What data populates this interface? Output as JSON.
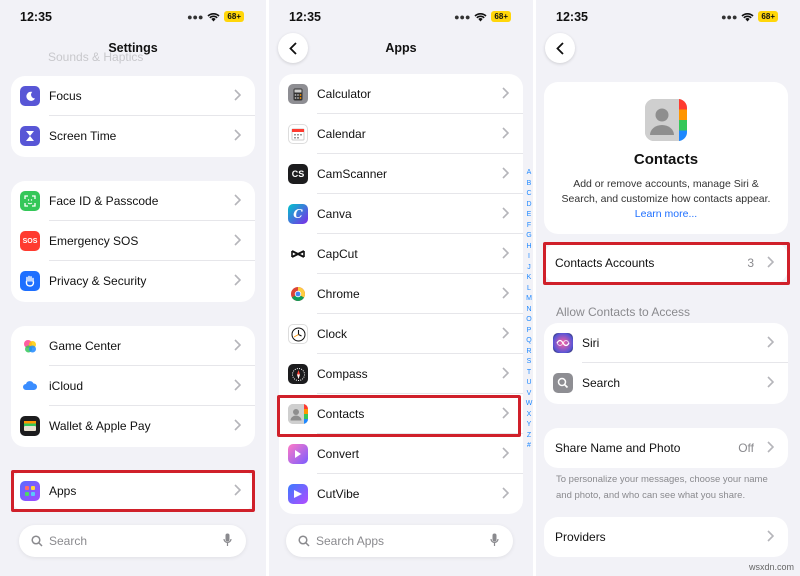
{
  "status": {
    "time": "12:35",
    "battery": "68+"
  },
  "settings": {
    "title": "Settings",
    "faded_top": "Sounds & Haptics",
    "groups": [
      [
        {
          "label": "Focus",
          "icon": "moon-icon",
          "color": "#5856d6"
        },
        {
          "label": "Screen Time",
          "icon": "hourglass-icon",
          "color": "#5856d6"
        }
      ],
      [
        {
          "label": "Face ID & Passcode",
          "icon": "faceid-icon",
          "color": "#34c759"
        },
        {
          "label": "Emergency SOS",
          "icon": "sos-icon",
          "color": "#ff3b30"
        },
        {
          "label": "Privacy & Security",
          "icon": "hand-icon",
          "color": "#1e6fff"
        }
      ],
      [
        {
          "label": "Game Center",
          "icon": "game-center-icon",
          "color": "#ffffff"
        },
        {
          "label": "iCloud",
          "icon": "cloud-icon",
          "color": "#ffffff"
        },
        {
          "label": "Wallet & Apple Pay",
          "icon": "wallet-icon",
          "color": "#1c1c1e"
        }
      ],
      [
        {
          "label": "Apps",
          "icon": "apps-grid-icon",
          "color": "#5856d6"
        }
      ]
    ],
    "search_placeholder": "Search"
  },
  "apps": {
    "title": "Apps",
    "items": [
      {
        "label": "Calculator",
        "icon": "calculator-icon",
        "color": "#8e8e93"
      },
      {
        "label": "Calendar",
        "icon": "calendar-icon",
        "color": "#ffffff"
      },
      {
        "label": "CamScanner",
        "icon": "camscanner-icon",
        "color": "#1c1c1e",
        "glyph": "CS"
      },
      {
        "label": "Canva",
        "icon": "canva-icon",
        "color": "#6b5bff",
        "glyph": "C"
      },
      {
        "label": "CapCut",
        "icon": "capcut-icon",
        "color": "#ffffff"
      },
      {
        "label": "Chrome",
        "icon": "chrome-icon",
        "color": "#ffffff"
      },
      {
        "label": "Clock",
        "icon": "clock-icon",
        "color": "#ffffff"
      },
      {
        "label": "Compass",
        "icon": "compass-icon",
        "color": "#1c1c1e"
      },
      {
        "label": "Contacts",
        "icon": "contacts-icon",
        "color": "#c7c7cc"
      },
      {
        "label": "Convert",
        "icon": "convert-icon",
        "color": "#ff6bb5"
      },
      {
        "label": "CutVibe",
        "icon": "cutvibe-icon",
        "color": "#3a7bff"
      }
    ],
    "alphabet": [
      "A",
      "B",
      "C",
      "D",
      "E",
      "F",
      "G",
      "H",
      "I",
      "J",
      "K",
      "L",
      "M",
      "N",
      "O",
      "P",
      "Q",
      "R",
      "S",
      "T",
      "U",
      "V",
      "W",
      "X",
      "Y",
      "Z",
      "#"
    ],
    "search_placeholder": "Search Apps"
  },
  "contacts": {
    "title": "Contacts",
    "description": "Add or remove accounts, manage Siri & Search, and customize how contacts appear.",
    "learn_more": "Learn more...",
    "accounts_label": "Contacts Accounts",
    "accounts_count": "3",
    "allow_header": "Allow Contacts to Access",
    "access": [
      {
        "label": "Siri",
        "icon": "siri-icon"
      },
      {
        "label": "Search",
        "icon": "search-app-icon"
      }
    ],
    "share_label": "Share Name and Photo",
    "share_value": "Off",
    "share_note": "To personalize your messages, choose your name and photo, and who can see what you share.",
    "providers_label": "Providers"
  },
  "watermark": "wsxdn.com",
  "accent": "#d0202a"
}
